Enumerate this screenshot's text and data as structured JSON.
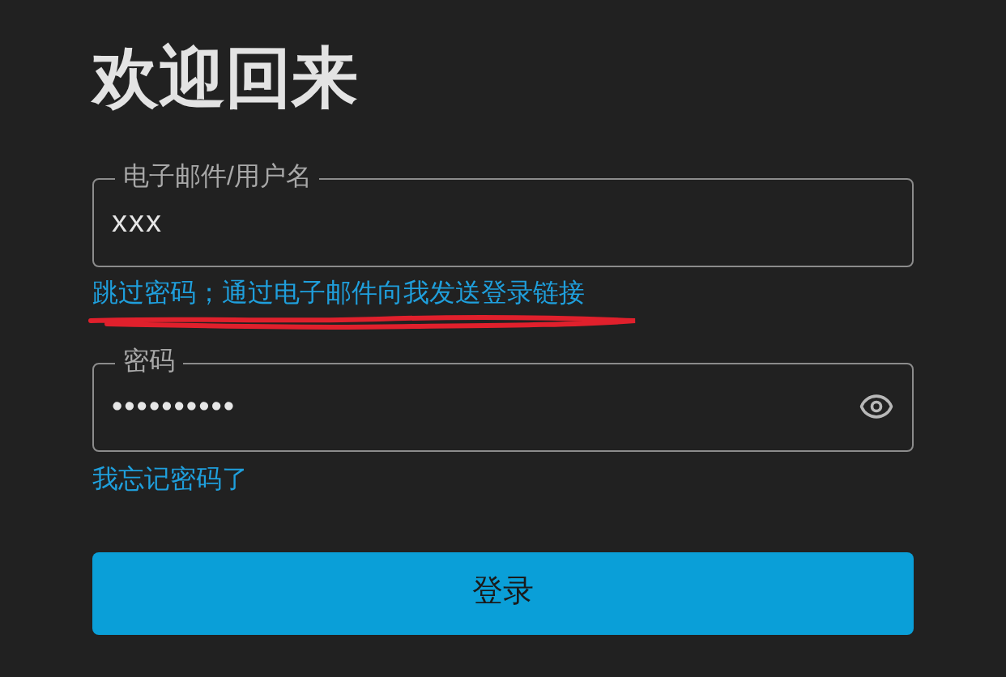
{
  "title": "欢迎回来",
  "email_field": {
    "label": "电子邮件/用户名",
    "value": "xxx"
  },
  "magic_link": "跳过密码；通过电子邮件向我发送登录链接",
  "password_field": {
    "label": "密码",
    "value": "••••••••••"
  },
  "forgot_link": "我忘记密码了",
  "login_button": "登录"
}
